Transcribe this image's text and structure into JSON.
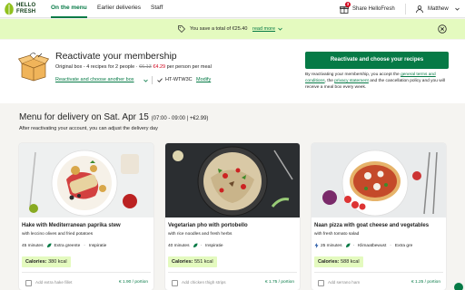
{
  "nav": {
    "logo_line1": "HELLO",
    "logo_line2": "FRESH",
    "tabs": [
      {
        "label": "On the menu",
        "active": true
      },
      {
        "label": "Earlier deliveries",
        "active": false
      },
      {
        "label": "Staff",
        "active": false
      }
    ],
    "share_label": "Share HelloFresh",
    "share_badge": "3",
    "user_name": "Matthew"
  },
  "banner": {
    "message": "You save a total of €25.40",
    "more_label": "read more",
    "icon": "tag-icon",
    "close_icon": "close-circle-icon"
  },
  "reactivate": {
    "title": "Reactivate your membership",
    "info_prefix": "Original box - 4 recipes for 2 people · ",
    "old_price": "€6.13",
    "new_price": "€4.29",
    "info_suffix": " per person per meal",
    "alt_link": "Reactivate and choose another box",
    "code": "HT-WTW3C",
    "modify_label": "Modify",
    "cta_label": "Reactivate and choose your recipes",
    "legal_prefix": "By reactivating your membership, you accept the ",
    "legal_link1": "general terms and conditions",
    "legal_mid": ", the ",
    "legal_link2": "privacy statement",
    "legal_suffix": " and the cancellation policy and you will receive a meal box every week."
  },
  "menu": {
    "title": "Menu for delivery on Sat. Apr 15",
    "time": "(07:00 - 09:00 | +€2.99)",
    "subtitle": "After reactivating your account, you can adjust the delivery day"
  },
  "recipes": [
    {
      "title": "Hake with Mediterranean paprika stew",
      "subtitle": "with leccino olives and fried potatoes",
      "time": "45 minutes",
      "tag1": "Extra greente",
      "tag2": "Inspiratie",
      "calories_label": "Calories:",
      "calories_value": "380 kcal",
      "addon": "Add extra hake fillet",
      "price": "€ 1.90 / portion"
    },
    {
      "title": "Vegetarian pho with portobello",
      "subtitle": "with rice noodles and fresh herbs",
      "time": "40 minutes",
      "tag1": "Inspiratie",
      "tag2": "",
      "calories_label": "Calories:",
      "calories_value": "551 kcal",
      "addon": "Add chicken thigh strips",
      "price": "€ 1.75 / portion"
    },
    {
      "title": "Naan pizza with goat cheese and vegetables",
      "subtitle": "with fresh tomato salad",
      "time": "25 minutes",
      "tag1": "Klimaatbewust",
      "tag2": "Extra gre",
      "calories_label": "Calories:",
      "calories_value": "588 kcal",
      "addon": "Add serrano ham",
      "price": "€ 1.25 / portion"
    }
  ],
  "colors": {
    "brand_green": "#067a46",
    "banner_bg": "#e4fabf",
    "price_red": "#d0021b"
  }
}
